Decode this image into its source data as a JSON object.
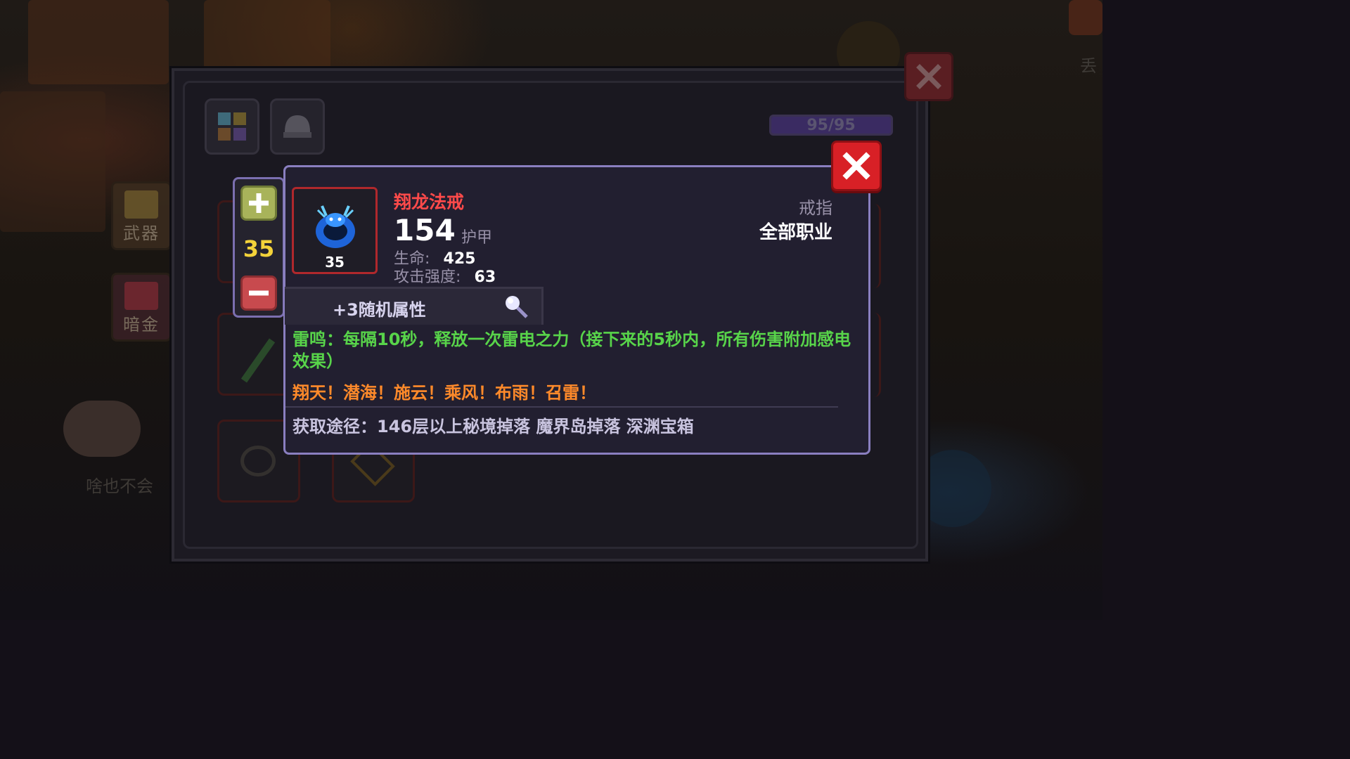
{
  "background": {
    "tabs": [
      {
        "label": "武器"
      },
      {
        "label": "暗金"
      }
    ],
    "faded_text": "啥也不会",
    "corner_text": "丢"
  },
  "inventory": {
    "capacity": "95/95"
  },
  "stepper": {
    "value": "35"
  },
  "item": {
    "name": "翔龙法戒",
    "level": "35",
    "armor_value": "154",
    "armor_label": "护甲",
    "stats": [
      {
        "label": "生命:",
        "value": "425"
      },
      {
        "label": "攻击强度:",
        "value": "63"
      }
    ],
    "type": "戒指",
    "class_restriction": "全部职业",
    "random_attributes": "+3随机属性",
    "effect": "雷鸣：每隔10秒，释放一次雷电之力（接下来的5秒内，所有伤害附加感电效果）",
    "flavor": "翔天！潜海！施云！乘风！布雨！召雷！",
    "source": "获取途径：146层以上秘境掉落 魔界岛掉落 深渊宝箱",
    "colors": {
      "name": "#ff4a4a",
      "effect": "#58d44a",
      "flavor": "#ff8a2a",
      "frame": "#b0282c"
    }
  }
}
